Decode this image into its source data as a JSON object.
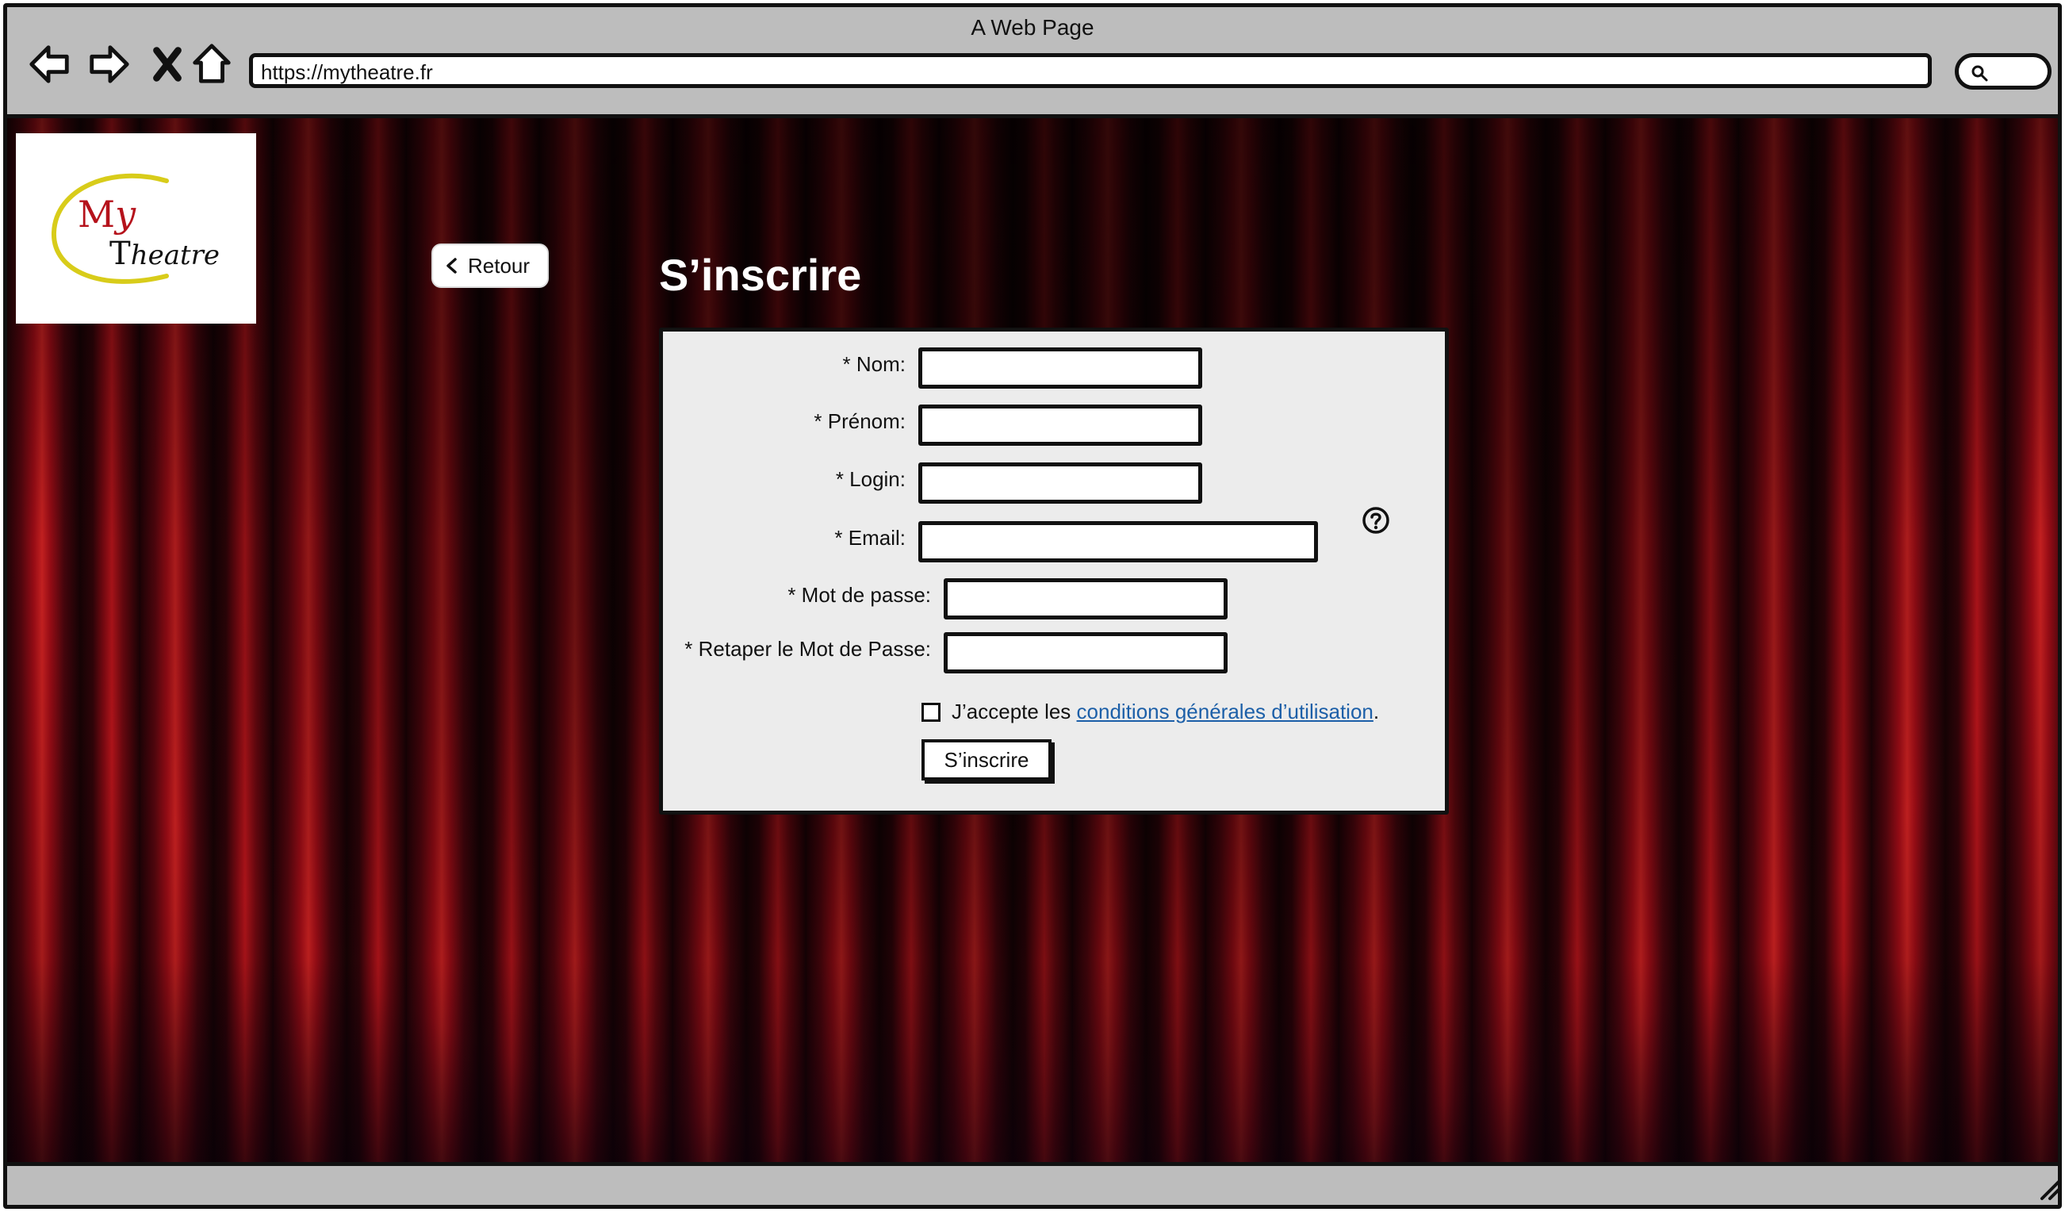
{
  "window": {
    "title": "A Web Page",
    "url": "https://mytheatre.fr"
  },
  "nav": {
    "back_icon": "arrow-left-icon",
    "forward_icon": "arrow-right-icon",
    "stop_icon": "close-icon",
    "home_icon": "home-icon",
    "search_icon": "search-icon"
  },
  "logo": {
    "line1": "My",
    "line2": "Theatre",
    "colors": {
      "my": "#b5121b",
      "ring": "#d8cc1a",
      "text": "#111111"
    }
  },
  "header": {
    "back_label": "Retour",
    "page_title": "S’inscrire"
  },
  "form": {
    "fields": [
      {
        "label": "* Nom:",
        "value": ""
      },
      {
        "label": "* Prénom:",
        "value": ""
      },
      {
        "label": "* Login:",
        "value": ""
      },
      {
        "label": "* Email:",
        "value": ""
      },
      {
        "label": "* Mot de passe:",
        "value": ""
      },
      {
        "label": "* Retaper le Mot de Passe:",
        "value": ""
      }
    ],
    "help_icon": "question-circle-icon",
    "agree_prefix": "J’accepte les ",
    "agree_link": "conditions générales d’utilisation",
    "agree_suffix": ".",
    "agree_checked": false,
    "submit_label": "S’inscrire"
  },
  "colors": {
    "chrome": "#bdbdbd",
    "panel": "#ececec",
    "link": "#1c5fa8",
    "curtain": "#c8101c"
  }
}
